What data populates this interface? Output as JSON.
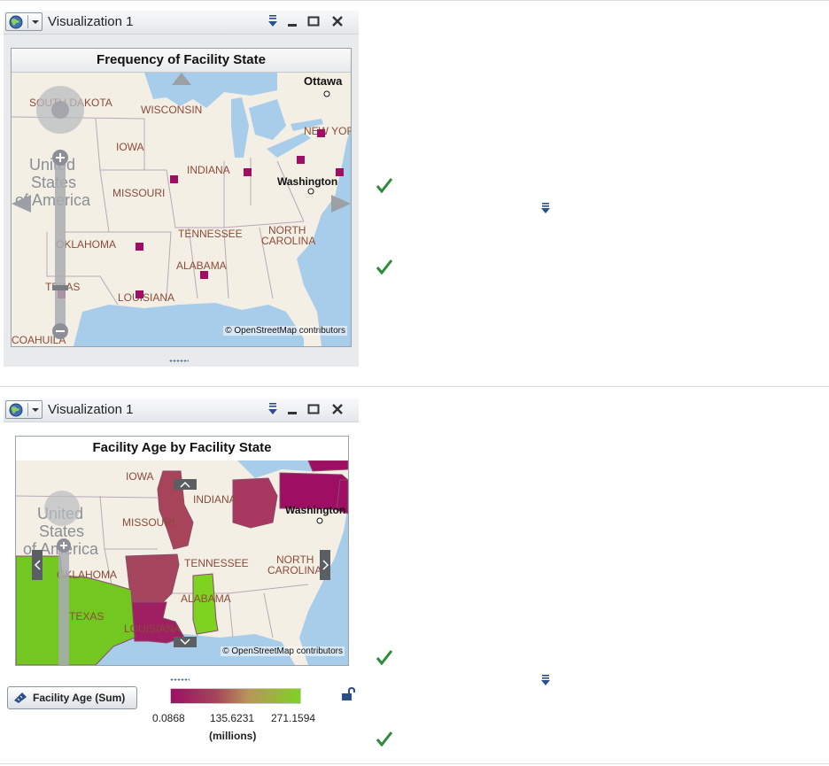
{
  "panel1": {
    "window_title": "Visualization 1",
    "map_title": "Frequency of Facility State",
    "labels": {
      "ottawa": "Ottawa",
      "south_dakota": "SOUTH DAKOTA",
      "wisconsin": "WISCONSIN",
      "new_york": "NEW YORK",
      "iowa": "IOWA",
      "united": "United",
      "states": "States",
      "of_america": "of America",
      "indiana": "INDIANA",
      "washington": "Washington",
      "missouri": "MISSOURI",
      "tennessee": "TENNESSEE",
      "north": "NORTH",
      "carolina": "CAROLINA",
      "oklahoma": "OKLAHOMA",
      "alabama": "ALABAMA",
      "texas": "TEXAS",
      "louisiana": "LOUISIANA",
      "coahuila": "COAHUILA"
    },
    "attribution": "© OpenStreetMap contributors",
    "marker_color": "#9e0f63"
  },
  "panel2": {
    "window_title": "Visualization 1",
    "map_title": "Facility Age by Facility State",
    "labels": {
      "iowa": "IOWA",
      "united": "United",
      "states": "States",
      "of_america": "of America",
      "indiana": "INDIANA",
      "washington": "Washington",
      "missouri": "MISSOURI",
      "tennessee": "TENNESSEE",
      "north": "NORTH",
      "carolina": "CAROLINA",
      "oklahoma": "OKLAHOMA",
      "alabama": "ALABAMA",
      "texas": "TEXAS",
      "louisiana": "LOUISIANA"
    },
    "attribution": "© OpenStreetMap contributors",
    "legend": {
      "button_label": "Facility Age (Sum)",
      "min": "0.0868",
      "mid": "135.6231",
      "max": "271.1594",
      "units": "(millions)",
      "color_low": "#9e0f63",
      "color_high": "#7ed321"
    }
  },
  "colors": {
    "check": "#2e8b3a",
    "accent": "#2a4f88"
  }
}
